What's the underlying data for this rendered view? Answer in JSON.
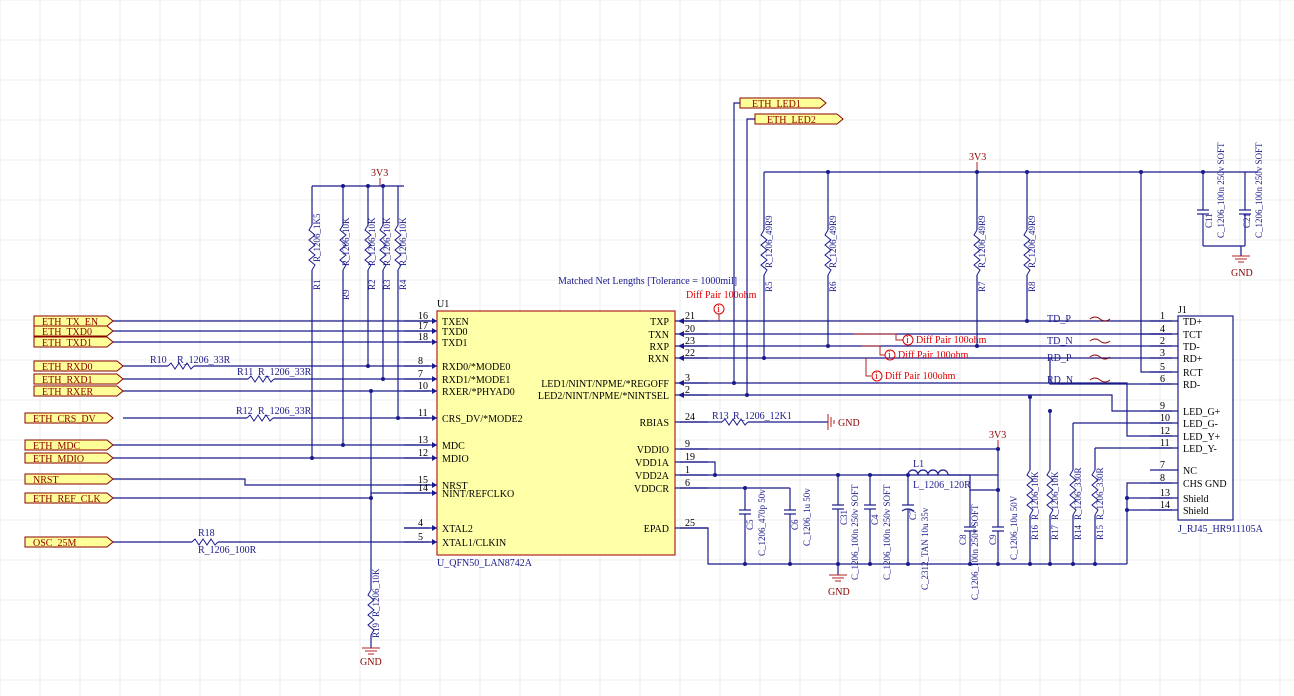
{
  "power": {
    "rail_3v3": "3V3",
    "gnd": "GND"
  },
  "annotation": {
    "matched_lengths": "Matched Net Lengths [Tolerance = 1000mil]",
    "diff_pair": "Diff Pair 100ohm",
    "rule_icon": "i"
  },
  "net_labels": {
    "td_p": "TD_P",
    "td_n": "TD_N",
    "rd_p": "RD_P",
    "rd_n": "RD_N"
  },
  "ports_left": [
    "ETH_TX_EN",
    "ETH_TXD0",
    "ETH_TXD1",
    "ETH_RXD0",
    "ETH_RXD1",
    "ETH_RXER",
    "ETH_CRS_DV",
    "ETH_MDC",
    "ETH_MDIO",
    "NRST",
    "ETH_REF_CLK",
    "OSC_25M"
  ],
  "ports_top": [
    "ETH_LED1",
    "ETH_LED2"
  ],
  "u1": {
    "designator": "U1",
    "part": "U_QFN50_LAN8742A",
    "left_pins": [
      {
        "num": "16",
        "name": "TXEN"
      },
      {
        "num": "17",
        "name": "TXD0"
      },
      {
        "num": "18",
        "name": "TXD1"
      },
      {
        "num": "8",
        "name": "RXD0/*MODE0"
      },
      {
        "num": "7",
        "name": "RXD1/*MODE1"
      },
      {
        "num": "10",
        "name": "RXER/*PHYAD0"
      },
      {
        "num": "11",
        "name": "CRS_DV/*MODE2"
      },
      {
        "num": "13",
        "name": "MDC"
      },
      {
        "num": "12",
        "name": "MDIO"
      },
      {
        "num": "15",
        "name": "NRST"
      },
      {
        "num": "14",
        "name": "NINT/REFCLKO"
      },
      {
        "num": "4",
        "name": "XTAL2"
      },
      {
        "num": "5",
        "name": "XTAL1/CLKIN"
      }
    ],
    "right_pins": [
      {
        "num": "21",
        "name": "TXP"
      },
      {
        "num": "20",
        "name": "TXN"
      },
      {
        "num": "23",
        "name": "RXP"
      },
      {
        "num": "22",
        "name": "RXN"
      },
      {
        "num": "3",
        "name": "LED1/NINT/NPME/*REGOFF"
      },
      {
        "num": "2",
        "name": "LED2/NINT/NPME/*NINTSEL"
      },
      {
        "num": "24",
        "name": "RBIAS"
      },
      {
        "num": "9",
        "name": "VDDIO"
      },
      {
        "num": "19",
        "name": "VDD1A"
      },
      {
        "num": "1",
        "name": "VDD2A"
      },
      {
        "num": "6",
        "name": "VDDCR"
      },
      {
        "num": "25",
        "name": "EPAD"
      }
    ]
  },
  "j1": {
    "designator": "J1",
    "part": "J_RJ45_HR911105A",
    "pins": [
      {
        "num": "1",
        "name": "TD+"
      },
      {
        "num": "4",
        "name": "TCT"
      },
      {
        "num": "2",
        "name": "TD-"
      },
      {
        "num": "3",
        "name": "RD+"
      },
      {
        "num": "5",
        "name": "RCT"
      },
      {
        "num": "6",
        "name": "RD-"
      },
      {
        "num": "9",
        "name": "LED_G+"
      },
      {
        "num": "10",
        "name": "LED_G-"
      },
      {
        "num": "12",
        "name": "LED_Y+"
      },
      {
        "num": "11",
        "name": "LED_Y-"
      },
      {
        "num": "7",
        "name": "NC"
      },
      {
        "num": "8",
        "name": "CHS GND"
      },
      {
        "num": "13",
        "name": "Shield"
      },
      {
        "num": "14",
        "name": "Shield"
      }
    ]
  },
  "components": {
    "r1": "R1",
    "r1v": "R_1206_1K5",
    "r9": "R9",
    "r9v": "R_1206_10K",
    "r2": "R2",
    "r2v": "R_1206_10K",
    "r3": "R3",
    "r3v": "R_1206_10K",
    "r4": "R4",
    "r4v": "R_1206_10K",
    "r10": "R10",
    "r10v": "R_1206_33R",
    "r11": "R11",
    "r11v": "R_1206_33R",
    "r12": "R12",
    "r12v": "R_1206_33R",
    "r18": "R18",
    "r18v": "R_1206_100R",
    "r19": "R19",
    "r19v": "R_1206_10K",
    "r13": "R13",
    "r13v": "R_1206_12K1",
    "r5": "R5",
    "r5v": "R_1206_49R9",
    "r6": "R6",
    "r6v": "R_1206_49R9",
    "r7": "R7",
    "r7v": "R_1206_49R9",
    "r8": "R8",
    "r8v": "R_1206_49R9",
    "r16": "R16",
    "r16v": "R_1206_10K",
    "r17": "R17",
    "r17v": "R_1206_10K",
    "r14": "R14",
    "r14v": "R_1206_330R",
    "r15": "R15",
    "r15v": "R_1206_330R",
    "c5": "C5",
    "c5v": "C_1206_470p 50v",
    "c6": "C6",
    "c6v": "C_1206_1u 50v",
    "c31": "C31",
    "c31v": "C_1206_100n 250v SOFT",
    "c4": "C4",
    "c4v": "C_1206_100n 250v SOFT",
    "c7": "C7",
    "c7v": "C_2312_TAN 10u 35v",
    "c8": "C8",
    "c8v": "C_1206_100n 250v SOFT",
    "c9": "C9",
    "c9v": "C_1206_10u 50V",
    "c11": "C11",
    "c11v": "C_1206_100n 250v SOFT",
    "c21": "C21",
    "c21v": "C_1206_100n 250v SOFT",
    "l1": "L1",
    "l1v": "L_1206_120R"
  }
}
